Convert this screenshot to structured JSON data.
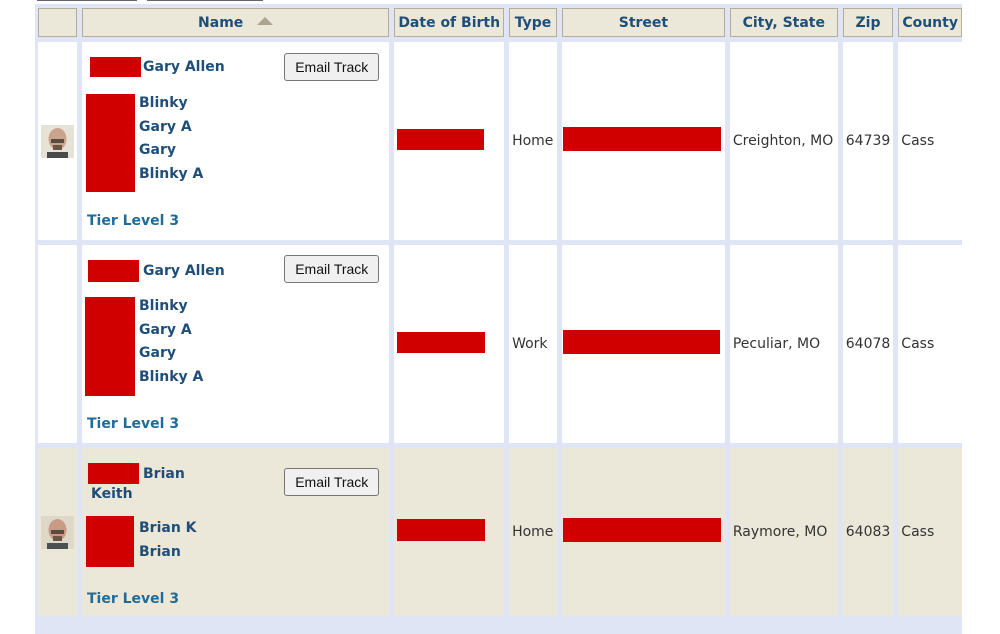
{
  "table": {
    "headers": {
      "photo": "",
      "name": "Name",
      "dob": "Date of Birth",
      "type": "Type",
      "street": "Street",
      "city_state": "City, State",
      "zip": "Zip",
      "county": "County"
    },
    "sort": {
      "column": "name",
      "direction": "ascending",
      "icon": "sort-up-icon"
    },
    "rows": [
      {
        "has_photo": true,
        "primary_name": "Gary Allen",
        "aliases": [
          "Blinky",
          "Gary A",
          "Gary",
          "Blinky A"
        ],
        "tier": "Tier Level 3",
        "email_button": "Email Track",
        "dob": "[redacted]",
        "type": "Home",
        "street": "[redacted]",
        "city_state": "Creighton, MO",
        "zip": "64739",
        "county": "Cass"
      },
      {
        "has_photo": false,
        "primary_name": "Gary Allen",
        "aliases": [
          "Blinky",
          "Gary A",
          "Gary",
          "Blinky A"
        ],
        "tier": "Tier Level 3",
        "email_button": "Email Track",
        "dob": "[redacted]",
        "type": "Work",
        "street": "[redacted]",
        "city_state": "Peculiar, MO",
        "zip": "64078",
        "county": "Cass"
      },
      {
        "has_photo": true,
        "primary_name": "Brian",
        "primary_name_line2": "Keith",
        "aliases": [
          "Brian K",
          "Brian"
        ],
        "tier": "Tier Level 3",
        "email_button": "Email Track",
        "dob": "[redacted]",
        "type": "Home",
        "street": "[redacted]",
        "city_state": "Raymore, MO",
        "zip": "64083",
        "county": "Cass"
      }
    ]
  },
  "colors": {
    "redaction": "#d00000",
    "header_bg": "#ebe7d9",
    "grid_bg": "#dfe5f5",
    "link_blue": "#1f4e78"
  }
}
